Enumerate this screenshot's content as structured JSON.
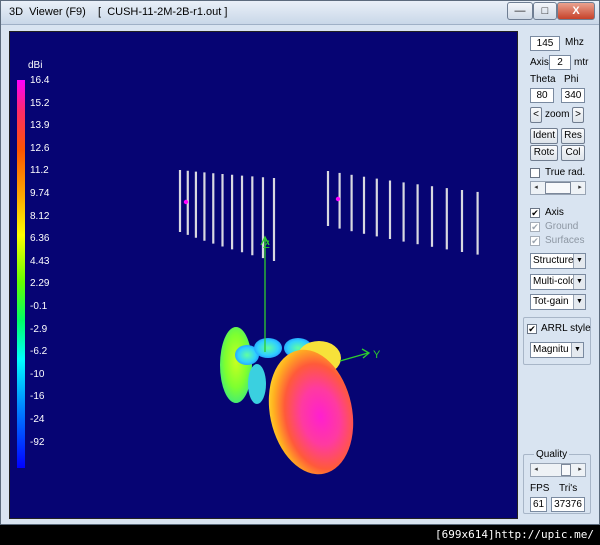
{
  "window": {
    "title": "3D  Viewer (F9)    [  CUSH-11-2M-2B-r1.out ]",
    "minimize_glyph": "—",
    "maximize_glyph": "□",
    "close_glyph": "X"
  },
  "scale": {
    "unit": "dBi",
    "labels": [
      "16.4",
      "15.2",
      "13.9",
      "12.6",
      "11.2",
      "9.74",
      "8.12",
      "6.36",
      "4.43",
      "2.29",
      "-0.1",
      "-2.9",
      "-6.2",
      "-10",
      "-16",
      "-24",
      "-92"
    ]
  },
  "axes": {
    "z": "Z",
    "y": "Y"
  },
  "controls": {
    "frequency_value": "145",
    "frequency_unit": "Mhz",
    "axis_label": "Axis",
    "axis_value": "2",
    "axis_unit": "mtr",
    "theta_label": "Theta",
    "phi_label": "Phi",
    "theta_value": "80",
    "phi_value": "340",
    "zoom_left": "<",
    "zoom_label": "zoom",
    "zoom_right": ">",
    "ident_label": "Ident",
    "res_label": "Res",
    "rotc_label": "Rotc",
    "col_label": "Col",
    "true_rad_label": "True rad.",
    "axis_check_label": "Axis",
    "ground_label": "Ground",
    "surfaces_label": "Surfaces",
    "structure_select": "Structure",
    "color_select": "Multi-colo",
    "gain_select": "Tot-gain",
    "arrl_label": "ARRL style",
    "magnitude_select": "Magnitu",
    "quality_label": "Quality",
    "fps_label": "FPS",
    "tris_label": "Tri's",
    "fps_value": "61",
    "tris_value": "37376",
    "checks": {
      "true_rad": "",
      "axis": "✔",
      "ground": "✔",
      "surfaces": "✔",
      "arrl": "✔"
    }
  },
  "footer": {
    "text": "[699x614]http://upic.me/"
  },
  "colors": {
    "viewport_bg": "#060473",
    "structure": "#d8d8e0",
    "axis": "#2ecc2e",
    "feedpoint": "#ff00ff"
  }
}
